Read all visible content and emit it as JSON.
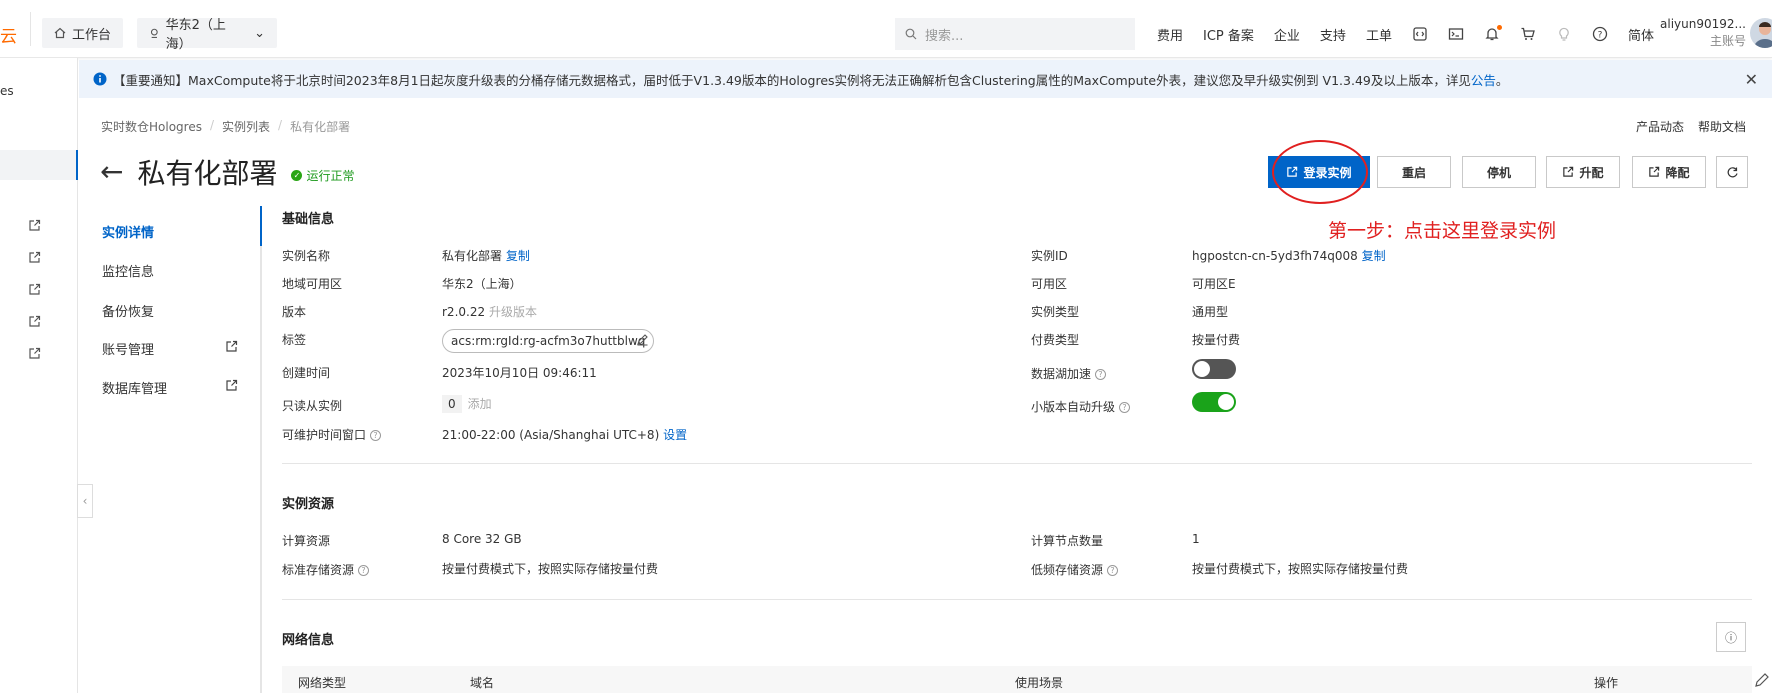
{
  "topbar": {
    "logo_text": "云",
    "workbench": "工作台",
    "region": "华东2（上海）",
    "search_placeholder": "搜索...",
    "nav": [
      "费用",
      "ICP 备案",
      "企业",
      "支持",
      "工单"
    ],
    "lang": "简体",
    "user_name": "aliyun90192...",
    "user_role": "主账号"
  },
  "leftnav": {
    "partial_text": "es"
  },
  "notice": {
    "text": "【重要通知】MaxCompute将于北京时间2023年8月1日起灰度升级表的分桶存储元数据格式，届时低于V1.3.49版本的Hologres实例将无法正确解析包含Clustering属性的MaxCompute外表，建议您及早升级实例到 V1.3.49及以上版本，详见",
    "link": "公告",
    "end": "。"
  },
  "breadcrumb": [
    "实时数仓Hologres",
    "实例列表",
    "私有化部署"
  ],
  "toplinks": [
    "产品动态",
    "帮助文档"
  ],
  "page": {
    "title": "私有化部署",
    "status": "运行正常"
  },
  "buttons": {
    "login": "登录实例",
    "restart": "重启",
    "stop": "停机",
    "upgrade": "升配",
    "downgrade": "降配"
  },
  "annotation": "第一步：点击这里登录实例",
  "tabs": [
    "实例详情",
    "监控信息",
    "备份恢复",
    "账号管理",
    "数据库管理"
  ],
  "basic": {
    "title": "基础信息",
    "left": [
      {
        "label": "实例名称",
        "value": "私有化部署",
        "action": "复制"
      },
      {
        "label": "地域可用区",
        "value": "华东2（上海）"
      },
      {
        "label": "版本",
        "value": "r2.0.22",
        "action": "升级版本"
      },
      {
        "label": "标签",
        "value": "acs:rm:rgId:rg-acfm3o7huttblwq"
      },
      {
        "label": "创建时间",
        "value": "2023年10月10日 09:46:11"
      },
      {
        "label": "只读从实例",
        "value": "0",
        "action": "添加"
      },
      {
        "label": "可维护时间窗口",
        "value": "21:00-22:00 (Asia/Shanghai UTC+8)",
        "action": "设置"
      }
    ],
    "right": [
      {
        "label": "实例ID",
        "value": "hgpostcn-cn-5yd3fh74q008",
        "action": "复制"
      },
      {
        "label": "可用区",
        "value": "可用区E"
      },
      {
        "label": "实例类型",
        "value": "通用型"
      },
      {
        "label": "付费类型",
        "value": "按量付费"
      },
      {
        "label": "数据湖加速",
        "toggle_on": false
      },
      {
        "label": "小版本自动升级",
        "toggle_on": true
      }
    ]
  },
  "resources": {
    "title": "实例资源",
    "compute_label": "计算资源",
    "compute_value": "8 Core 32 GB",
    "std_storage_label": "标准存储资源",
    "std_storage_value": "按量付费模式下，按照实际存储按量付费",
    "nodes_label": "计算节点数量",
    "nodes_value": "1",
    "cold_storage_label": "低频存储资源",
    "cold_storage_value": "按量付费模式下，按照实际存储按量付费"
  },
  "network": {
    "title": "网络信息",
    "columns": [
      "网络类型",
      "域名",
      "使用场景",
      "操作"
    ]
  },
  "colors": {
    "primary": "#0064c8",
    "annotation": "#e02020",
    "brand": "#ff6a00",
    "toggle_on": "#1aa31a",
    "toggle_off": "#555555"
  }
}
